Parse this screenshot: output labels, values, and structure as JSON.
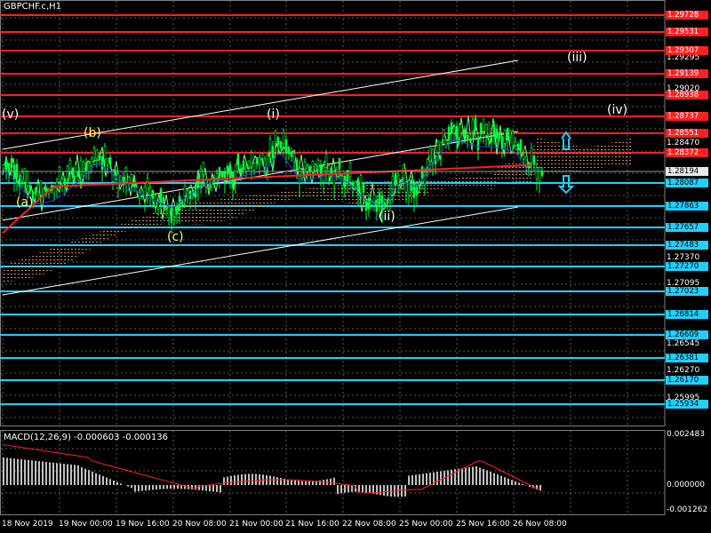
{
  "symbol_title": "GBPCHF.c,H1",
  "macd_title": "MACD(12,26,9) -0.000603 -0.000136",
  "colors": {
    "background": "#000000",
    "grid": "#5a5a5a",
    "resistance": "#ff2020",
    "support": "#20d0ff",
    "candles": "#00ff40",
    "ma_red": "#ff2020",
    "ma_blue": "#2a3aff",
    "channel": "#ffffff",
    "wave_white": "#ffffff",
    "wave_yellow": "#ffff60",
    "macd_hist": "#c0c0c0",
    "macd_signal": "#ff2020"
  },
  "price_axis": {
    "ticks": [
      "1.29295",
      "1.29020",
      "1.28470",
      "1.27370",
      "1.27095",
      "1.26545",
      "1.26270",
      "1.25995"
    ]
  },
  "resistance_levels": [
    "1.29728",
    "1.29531",
    "1.29307",
    "1.29139",
    "1.28938",
    "1.28737",
    "1.28551",
    "1.28372"
  ],
  "current_price": "1.28194",
  "support_levels": [
    "1.28087",
    "1.27863",
    "1.27657",
    "1.27483",
    "1.27270",
    "1.27023",
    "1.26814",
    "1.26609",
    "1.26381",
    "1.26170",
    "1.25934"
  ],
  "macd_axis": {
    "ticks": [
      "0.002483",
      "0.000000",
      "-0.001262"
    ]
  },
  "time_axis": [
    "18 Nov 2019",
    "19 Nov 00:00",
    "19 Nov 16:00",
    "20 Nov 08:00",
    "21 Nov 00:00",
    "21 Nov 16:00",
    "22 Nov 08:00",
    "25 Nov 00:00",
    "25 Nov 16:00",
    "26 Nov 08:00"
  ],
  "wave_labels": [
    {
      "text": "(v)",
      "color": "white"
    },
    {
      "text": "(a)",
      "color": "yellow"
    },
    {
      "text": "(b)",
      "color": "yellow"
    },
    {
      "text": "(c)",
      "color": "yellow"
    },
    {
      "text": "(i)",
      "color": "white"
    },
    {
      "text": "(ii)",
      "color": "white"
    },
    {
      "text": "(iii)",
      "color": "white"
    },
    {
      "text": "(iv)",
      "color": "white"
    }
  ],
  "arrows": [
    {
      "direction": "up",
      "icon": "up-arrow-icon"
    },
    {
      "direction": "down",
      "icon": "down-arrow-icon"
    }
  ]
}
